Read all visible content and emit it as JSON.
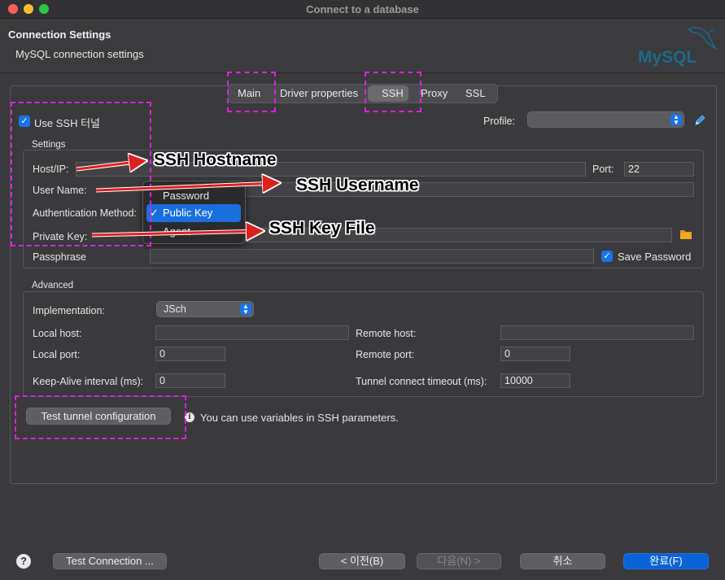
{
  "window": {
    "title": "Connect to a database"
  },
  "header": {
    "title": "Connection Settings",
    "subtitle": "MySQL connection settings",
    "logo_text": "MySQL"
  },
  "tabs": [
    {
      "label": "Main"
    },
    {
      "label": "Driver properties"
    },
    {
      "label": "SSH",
      "active": true
    },
    {
      "label": "Proxy"
    },
    {
      "label": "SSL"
    }
  ],
  "ssh": {
    "use_ssh_label": "Use SSH 터널",
    "use_ssh_checked": true,
    "profile_label": "Profile:",
    "profile_value": "",
    "settings_label": "Settings",
    "host_label": "Host/IP:",
    "host_value": "",
    "port_label": "Port:",
    "port_value": "22",
    "username_label": "User Name:",
    "username_value": "",
    "auth_label": "Authentication Method:",
    "auth_options": [
      "Password",
      "Public Key",
      "Agent"
    ],
    "auth_selected": "Public Key",
    "private_key_label": "Private Key:",
    "private_key_value": "",
    "passphrase_label": "Passphrase",
    "passphrase_value": "",
    "save_password_label": "Save Password",
    "save_password_checked": true
  },
  "advanced": {
    "label": "Advanced",
    "implementation_label": "Implementation:",
    "implementation_value": "JSch",
    "local_host_label": "Local host:",
    "local_host_value": "",
    "remote_host_label": "Remote host:",
    "remote_host_value": "",
    "local_port_label": "Local port:",
    "local_port_value": "0",
    "remote_port_label": "Remote port:",
    "remote_port_value": "0",
    "keepalive_label": "Keep-Alive interval (ms):",
    "keepalive_value": "0",
    "tunnel_timeout_label": "Tunnel connect timeout (ms):",
    "tunnel_timeout_value": "10000"
  },
  "test_tunnel": {
    "button_label": "Test tunnel configuration",
    "info_text": "You can use variables in SSH parameters."
  },
  "annotations": {
    "hostname": "SSH Hostname",
    "username": "SSH Username",
    "keyfile": "SSH Key File"
  },
  "footer": {
    "help": "?",
    "test_connection": "Test Connection ...",
    "back": "< 이전(B)",
    "next": "다음(N) >",
    "cancel": "취소",
    "finish": "완료(F)"
  },
  "colors": {
    "accent": "#1a73e8",
    "highlight_dash": "#e020e0",
    "annotation_arrow": "#e02020"
  }
}
